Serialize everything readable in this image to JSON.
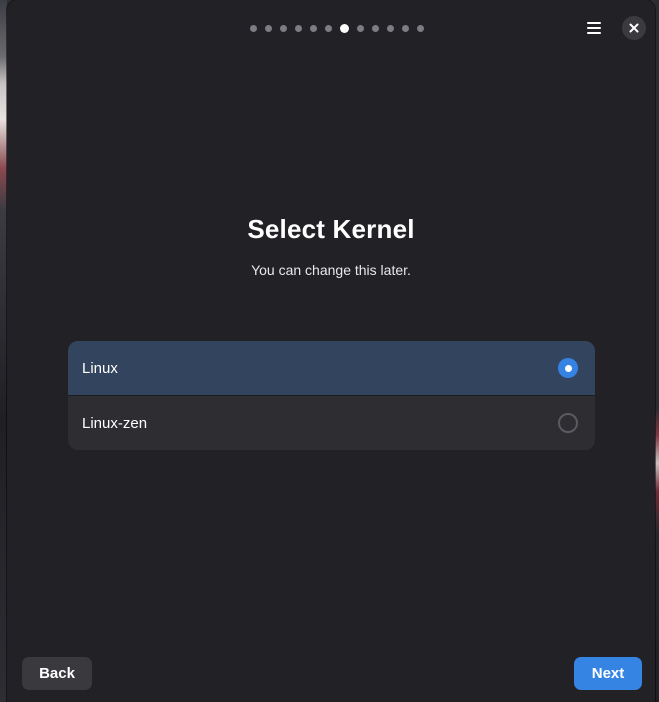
{
  "header": {
    "page_count": 12,
    "current_page": 7,
    "menu_icon": "hamburger-menu-icon",
    "close_icon": "close-icon"
  },
  "main": {
    "title": "Select Kernel",
    "subtitle": "You can change this later.",
    "options": [
      {
        "label": "Linux",
        "selected": true
      },
      {
        "label": "Linux-zen",
        "selected": false
      }
    ]
  },
  "footer": {
    "back_label": "Back",
    "next_label": "Next"
  },
  "colors": {
    "accent": "#3584e4",
    "selected_row": "#33445e",
    "window_bg": "#222226"
  }
}
